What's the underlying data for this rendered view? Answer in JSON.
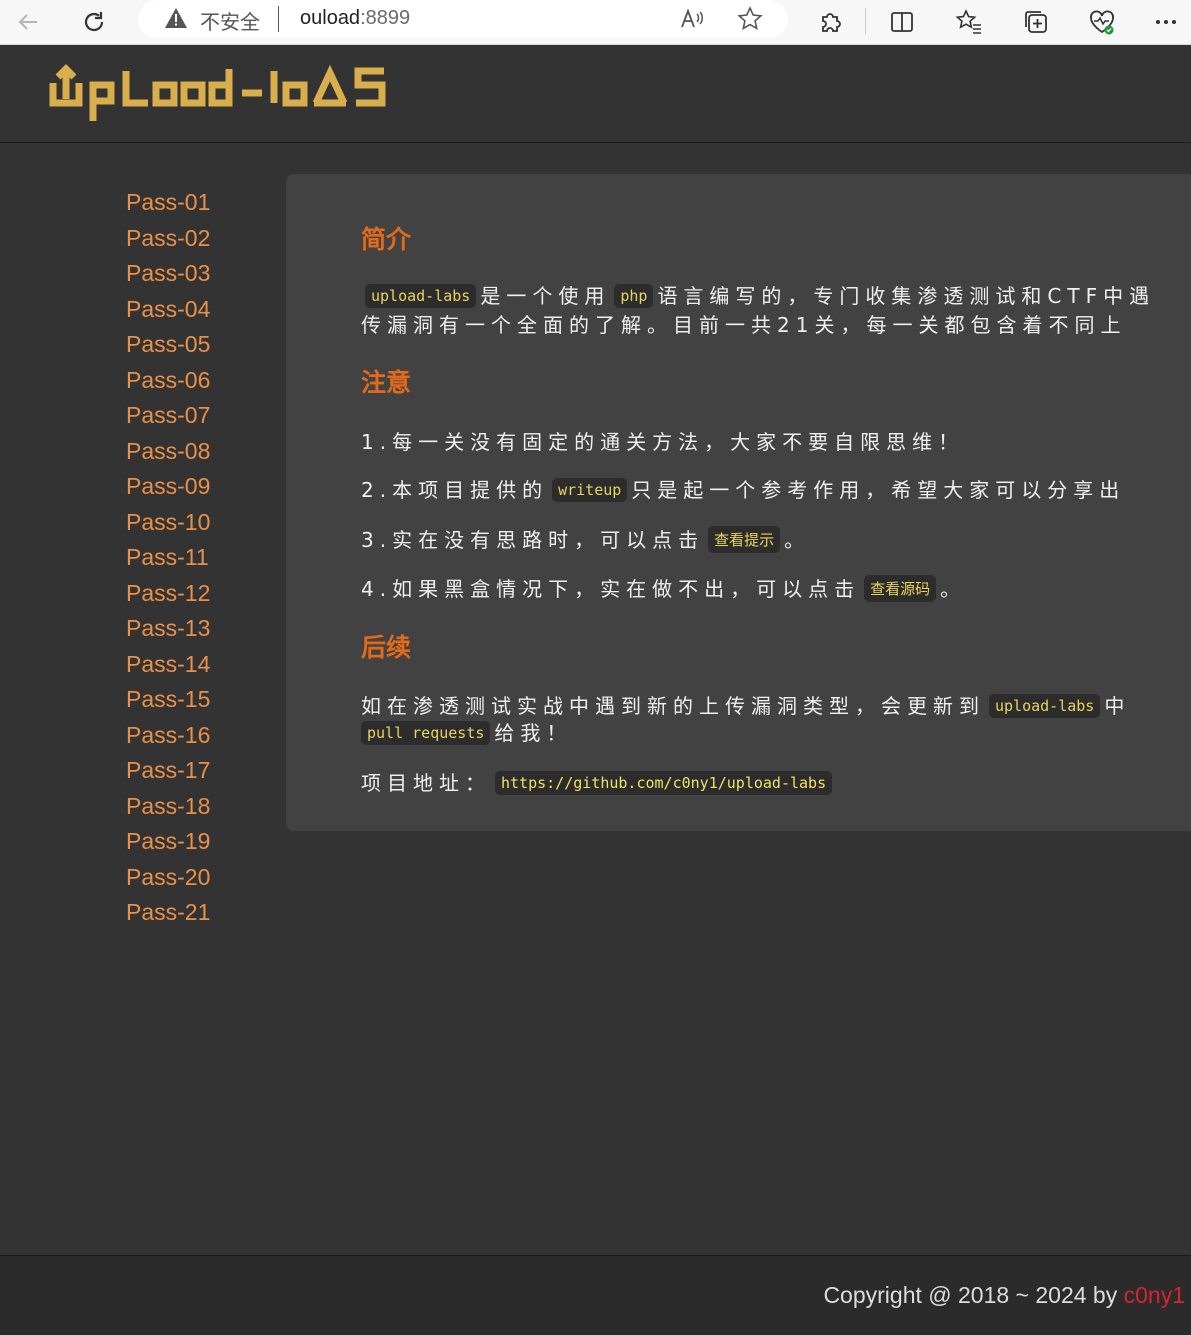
{
  "browser": {
    "security_label": "不安全",
    "url_host": "ouload",
    "url_port": ":8899",
    "icons": [
      "back-icon",
      "refresh-icon",
      "warning-icon",
      "read-aloud-icon",
      "favorite-star-icon",
      "extensions-icon",
      "split-screen-icon",
      "favorites-icon",
      "collections-icon",
      "browser-essentials-icon",
      "more-icon"
    ]
  },
  "header": {
    "logo_text": "Upload-labs"
  },
  "sidebar": {
    "items": [
      {
        "label": "Pass-01"
      },
      {
        "label": "Pass-02"
      },
      {
        "label": "Pass-03"
      },
      {
        "label": "Pass-04"
      },
      {
        "label": "Pass-05"
      },
      {
        "label": "Pass-06"
      },
      {
        "label": "Pass-07"
      },
      {
        "label": "Pass-08"
      },
      {
        "label": "Pass-09"
      },
      {
        "label": "Pass-10"
      },
      {
        "label": "Pass-11"
      },
      {
        "label": "Pass-12"
      },
      {
        "label": "Pass-13"
      },
      {
        "label": "Pass-14"
      },
      {
        "label": "Pass-15"
      },
      {
        "label": "Pass-16"
      },
      {
        "label": "Pass-17"
      },
      {
        "label": "Pass-18"
      },
      {
        "label": "Pass-19"
      },
      {
        "label": "Pass-20"
      },
      {
        "label": "Pass-21"
      }
    ]
  },
  "main": {
    "intro": {
      "title": "简介",
      "code1": "upload-labs",
      "text1": "是一个使用",
      "code2": "php",
      "text2": "语言编写的，专门收集渗透测试和CTF中遇",
      "line2": "传漏洞有一个全面的了解。目前一共21关，每一关都包含着不同上"
    },
    "notes": {
      "title": "注意",
      "n1": "1.每一关没有固定的通关方法，大家不要自限思维！",
      "n2_a": "2.本项目提供的",
      "n2_code": "writeup",
      "n2_b": "只是起一个参考作用，希望大家可以分享出",
      "n3_a": "3.实在没有思路时，可以点击",
      "n3_code": "查看提示",
      "n3_b": "。",
      "n4_a": "4.如果黑盒情况下，实在做不出，可以点击",
      "n4_code": "查看源码",
      "n4_b": "。"
    },
    "followup": {
      "title": "后续",
      "l1_a": "如在渗透测试实战中遇到新的上传漏洞类型，会更新到",
      "l1_code": "upload-labs",
      "l1_b": "中",
      "l2_code": "pull requests",
      "l2_b": "给我！",
      "addr_label": "项目地址：",
      "addr_url": "https://github.com/c0ny1/upload-labs"
    }
  },
  "footer": {
    "copyright": "Copyright @ 2018 ~ 2024 by ",
    "author": "c0ny1"
  },
  "colors": {
    "page_bg": "#333333",
    "panel_bg": "#424242",
    "nav_link": "#e9914a",
    "section_title": "#e26a1b",
    "code_text": "#e8d35f",
    "author": "#d8242f",
    "logo": "#d9ae4d"
  }
}
